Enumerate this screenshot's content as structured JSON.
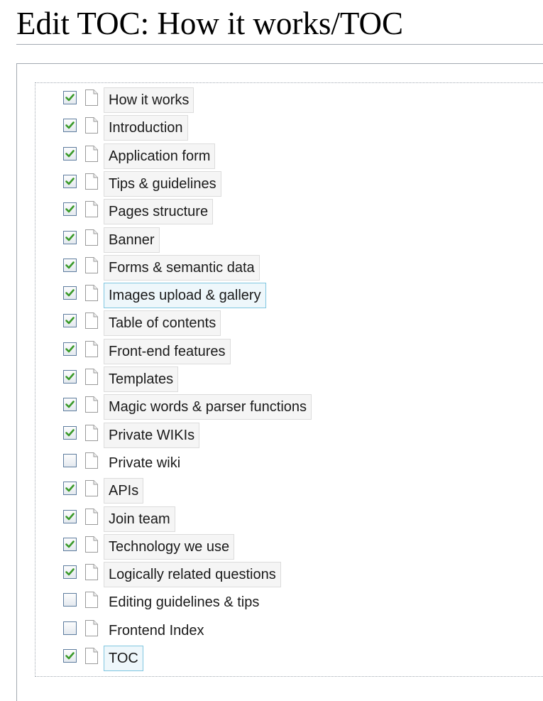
{
  "page": {
    "title": "Edit TOC: How it works/TOC"
  },
  "colors": {
    "checkmark": "#3a9a2a",
    "checkbox_border": "#5d7c9e",
    "selected_border": "#7fc6e0"
  },
  "toc": {
    "items": [
      {
        "label": "How it works",
        "checked": true,
        "selected": false,
        "icon": "page-icon"
      },
      {
        "label": "Introduction",
        "checked": true,
        "selected": false,
        "icon": "page-icon"
      },
      {
        "label": "Application form",
        "checked": true,
        "selected": false,
        "icon": "page-icon"
      },
      {
        "label": "Tips & guidelines",
        "checked": true,
        "selected": false,
        "icon": "page-icon"
      },
      {
        "label": "Pages structure",
        "checked": true,
        "selected": false,
        "icon": "page-icon"
      },
      {
        "label": "Banner",
        "checked": true,
        "selected": false,
        "icon": "page-icon"
      },
      {
        "label": "Forms & semantic data",
        "checked": true,
        "selected": false,
        "icon": "page-icon"
      },
      {
        "label": "Images upload & gallery",
        "checked": true,
        "selected": true,
        "icon": "page-icon"
      },
      {
        "label": "Table of contents",
        "checked": true,
        "selected": false,
        "icon": "page-icon"
      },
      {
        "label": "Front-end features",
        "checked": true,
        "selected": false,
        "icon": "page-icon"
      },
      {
        "label": "Templates",
        "checked": true,
        "selected": false,
        "icon": "page-icon"
      },
      {
        "label": "Magic words & parser functions",
        "checked": true,
        "selected": false,
        "icon": "page-icon"
      },
      {
        "label": "Private WIKIs",
        "checked": true,
        "selected": false,
        "icon": "page-icon"
      },
      {
        "label": "Private wiki",
        "checked": false,
        "selected": false,
        "icon": "page-icon"
      },
      {
        "label": "APIs",
        "checked": true,
        "selected": false,
        "icon": "page-icon"
      },
      {
        "label": "Join team",
        "checked": true,
        "selected": false,
        "icon": "page-icon"
      },
      {
        "label": "Technology we use",
        "checked": true,
        "selected": false,
        "icon": "page-icon"
      },
      {
        "label": "Logically related questions",
        "checked": true,
        "selected": false,
        "icon": "page-icon"
      },
      {
        "label": "Editing guidelines & tips",
        "checked": false,
        "selected": false,
        "icon": "page-icon"
      },
      {
        "label": "Frontend Index",
        "checked": false,
        "selected": false,
        "icon": "page-icon"
      },
      {
        "label": "TOC",
        "checked": true,
        "selected": true,
        "icon": "page-icon"
      }
    ]
  }
}
